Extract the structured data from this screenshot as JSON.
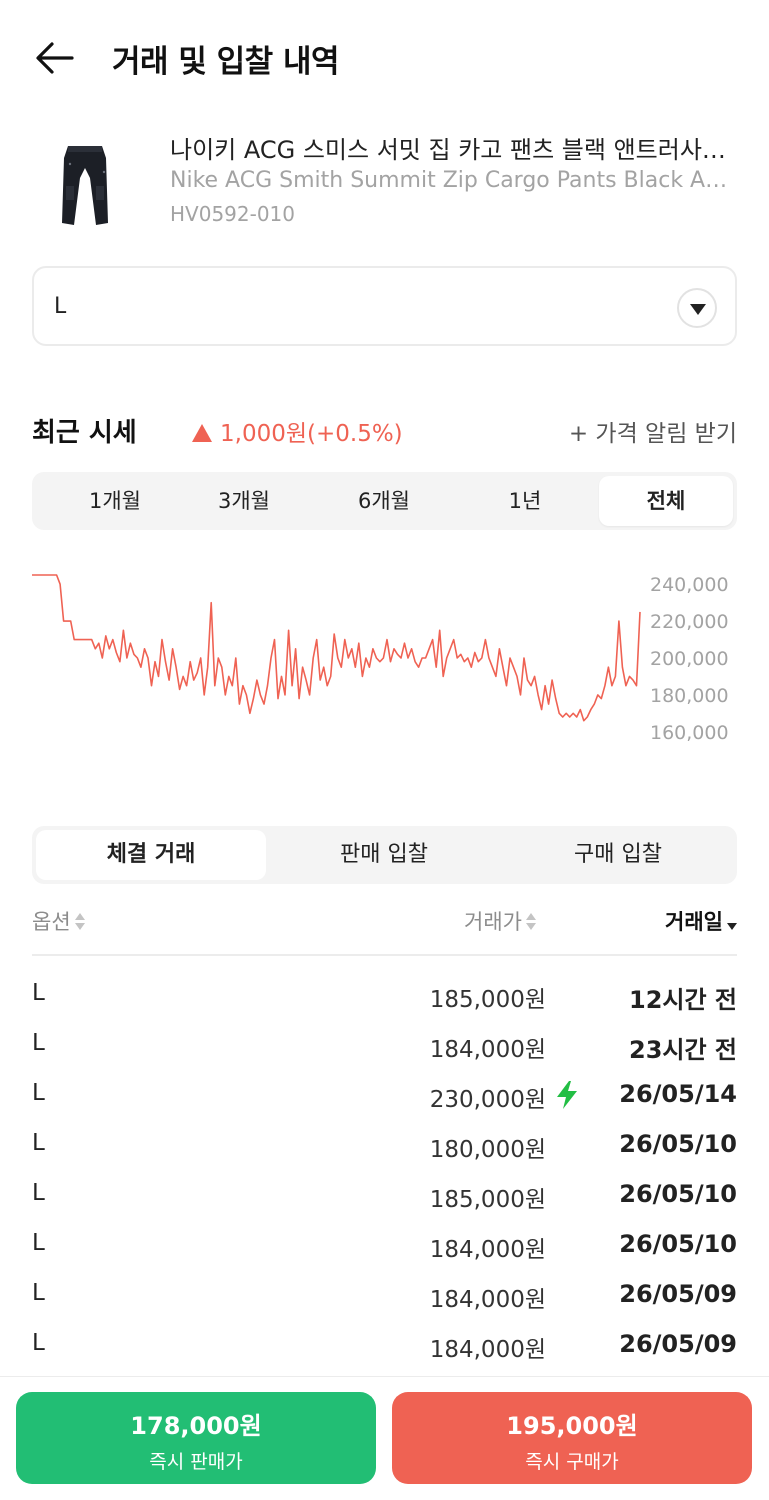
{
  "header": {
    "title": "거래 및 입찰 내역",
    "back_icon": "arrow-left-icon"
  },
  "product": {
    "name_ko": "나이키 ACG 스미스 서밋 집 카고 팬츠 블랙 앤트러사이트",
    "name_en": "Nike ACG Smith Summit Zip Cargo Pants Black Anthracite",
    "code": "HV0592-010"
  },
  "size_select": {
    "value": "L"
  },
  "recent_price": {
    "title": "최근 시세",
    "change": "1,000원(+0.5%)",
    "direction": "up",
    "alert_label": "+ 가격 알림 받기",
    "up_color": "#ef6253"
  },
  "period_tabs": [
    {
      "label": "1개월"
    },
    {
      "label": "3개월"
    },
    {
      "label": "6개월"
    },
    {
      "label": "1년"
    },
    {
      "label": "전체",
      "active": true
    }
  ],
  "chart_data": {
    "type": "line",
    "color": "#ef6253",
    "ylim": [
      155000,
      245000
    ],
    "yticks": [
      "240,000",
      "220,000",
      "200,000",
      "180,000",
      "160,000"
    ],
    "ytick_values": [
      240000,
      220000,
      200000,
      180000,
      160000
    ],
    "grid": false,
    "series": [
      {
        "values": [
          245000,
          245000,
          245000,
          245000,
          245000,
          245000,
          245000,
          245000,
          240000,
          220000,
          220000,
          220000,
          210000,
          210000,
          210000,
          210000,
          210000,
          210000,
          205000,
          208000,
          200000,
          212000,
          205000,
          210000,
          203000,
          198000,
          215000,
          200000,
          208000,
          202000,
          200000,
          195000,
          205000,
          200000,
          185000,
          198000,
          190000,
          210000,
          198000,
          188000,
          205000,
          195000,
          183000,
          190000,
          185000,
          198000,
          188000,
          192000,
          200000,
          180000,
          195000,
          230000,
          185000,
          200000,
          195000,
          180000,
          190000,
          185000,
          200000,
          175000,
          185000,
          180000,
          170000,
          178000,
          188000,
          180000,
          175000,
          185000,
          200000,
          210000,
          178000,
          190000,
          180000,
          215000,
          185000,
          205000,
          178000,
          195000,
          188000,
          180000,
          200000,
          210000,
          188000,
          195000,
          185000,
          190000,
          213000,
          200000,
          195000,
          210000,
          200000,
          205000,
          195000,
          208000,
          190000,
          200000,
          195000,
          205000,
          200000,
          198000,
          200000,
          210000,
          198000,
          205000,
          202000,
          200000,
          208000,
          200000,
          205000,
          198000,
          195000,
          200000,
          200000,
          205000,
          210000,
          195000,
          215000,
          190000,
          200000,
          205000,
          210000,
          200000,
          202000,
          198000,
          200000,
          195000,
          203000,
          198000,
          200000,
          210000,
          200000,
          195000,
          190000,
          205000,
          195000,
          185000,
          200000,
          195000,
          190000,
          180000,
          200000,
          188000,
          185000,
          190000,
          180000,
          172000,
          185000,
          175000,
          188000,
          178000,
          170000,
          168000,
          170000,
          168000,
          170000,
          168000,
          172000,
          166000,
          168000,
          172000,
          175000,
          180000,
          178000,
          185000,
          195000,
          185000,
          190000,
          220000,
          195000,
          185000,
          190000,
          188000,
          185000,
          225000
        ]
      }
    ]
  },
  "trade_tabs": [
    {
      "label": "체결 거래",
      "active": true
    },
    {
      "label": "판매 입찰"
    },
    {
      "label": "구매 입찰"
    }
  ],
  "table": {
    "headers": {
      "option": "옵션",
      "price": "거래가",
      "date": "거래일"
    },
    "rows": [
      {
        "option": "L",
        "price": "185,000원",
        "date": "12시간 전",
        "quick": false
      },
      {
        "option": "L",
        "price": "184,000원",
        "date": "23시간 전",
        "quick": false
      },
      {
        "option": "L",
        "price": "230,000원",
        "date": "26/05/14",
        "quick": true
      },
      {
        "option": "L",
        "price": "180,000원",
        "date": "26/05/10",
        "quick": false
      },
      {
        "option": "L",
        "price": "185,000원",
        "date": "26/05/10",
        "quick": false
      },
      {
        "option": "L",
        "price": "184,000원",
        "date": "26/05/10",
        "quick": false
      },
      {
        "option": "L",
        "price": "184,000원",
        "date": "26/05/09",
        "quick": false
      },
      {
        "option": "L",
        "price": "184,000원",
        "date": "26/05/09",
        "quick": false
      }
    ]
  },
  "bottom_buttons": {
    "sell": {
      "price": "178,000원",
      "label": "즉시 판매가",
      "color": "#22be74"
    },
    "buy": {
      "price": "195,000원",
      "label": "즉시 구매가",
      "color": "#ef6253"
    }
  }
}
